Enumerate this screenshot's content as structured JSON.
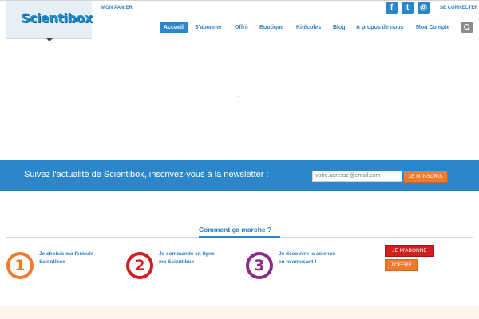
{
  "header": {
    "logo_text": "Scientibox",
    "cart_link": "MON PANIER",
    "login_link": "SE CONNECTER",
    "social": [
      {
        "name": "facebook",
        "glyph": "f"
      },
      {
        "name": "twitter",
        "glyph": "t"
      },
      {
        "name": "instagram",
        "glyph": "◎"
      }
    ]
  },
  "nav": {
    "items": [
      {
        "label": "Accueil",
        "active": true
      },
      {
        "label": "S'abonner"
      },
      {
        "label": "Offrir"
      },
      {
        "label": "Boutique"
      },
      {
        "label": "Kitécoles"
      },
      {
        "label": "Blog"
      },
      {
        "label": "À propos de nous"
      },
      {
        "label": "Mon Compte"
      }
    ]
  },
  "newsletter": {
    "text": "Suivez l'actualité de Scientibox, inscrivez-vous à la newsletter :",
    "input_value": "votre.adresse@email.com",
    "button_label": "JE M'INSCRIS"
  },
  "how": {
    "title": "Comment ça marche ?",
    "steps": [
      {
        "number": "1",
        "line1": "Je choisis ma formule",
        "line2": "Scientibox",
        "color": "#ef7b2d"
      },
      {
        "number": "2",
        "line1": "Je commande en ligne",
        "line2": "ma Scientibox",
        "color": "#d02020"
      },
      {
        "number": "3",
        "line1": "Je découvre la science",
        "line2": "en m'amusant !",
        "color": "#8e2a8a"
      }
    ],
    "subscribe_button": "JE M'ABONNE",
    "gift_button": "J'OFFRE"
  },
  "colors": {
    "brand_blue": "#2b87c9",
    "orange": "#ef7b2d",
    "red": "#d02020",
    "purple": "#8e2a8a"
  }
}
